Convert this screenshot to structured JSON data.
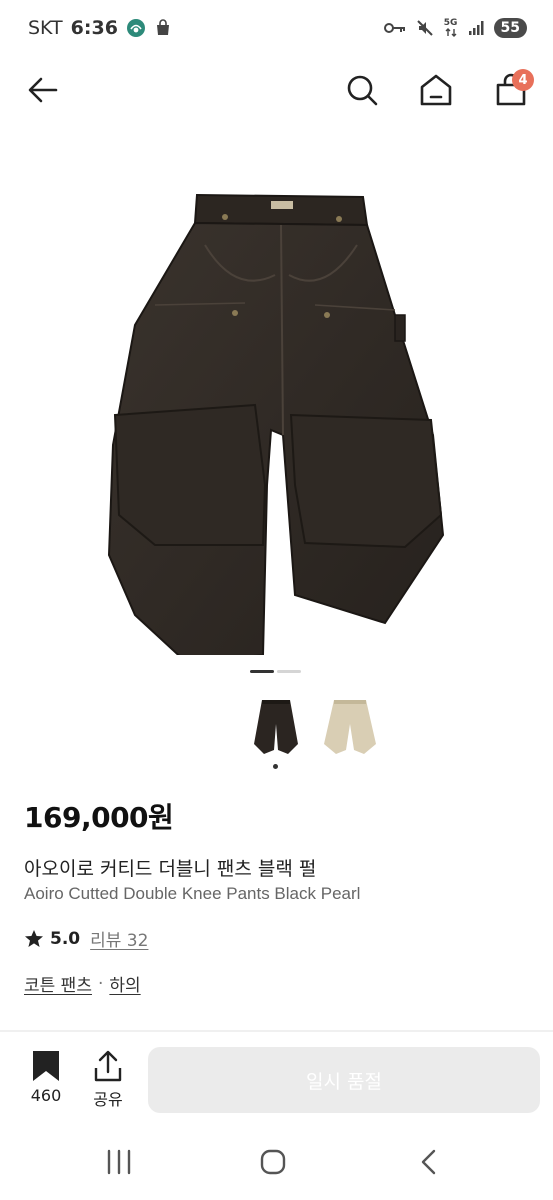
{
  "status": {
    "carrier": "SKT",
    "time": "6:36",
    "network": "5G",
    "battery": "55"
  },
  "header": {
    "back_icon": "arrow-left-icon",
    "search_icon": "search-icon",
    "home_icon": "home-icon",
    "cart_icon": "shopping-bag-icon",
    "cart_count": "4",
    "badge_color": "#e8705a"
  },
  "gallery": {
    "current_index": 1,
    "total": 2,
    "swatches": [
      "black",
      "beige"
    ]
  },
  "product": {
    "price": "169,000원",
    "name_ko": "아오이로 커티드 더블니 팬츠 블랙 펄",
    "name_en": "Aoiro Cutted Double Knee Pants Black Pearl",
    "rating": "5.0",
    "review_label": "리뷰 32",
    "category": "코튼 팬츠",
    "category_sep": "·",
    "subcategory": "하의"
  },
  "actions": {
    "like_count": "460",
    "share_label": "공유",
    "soldout_label": "일시 품절"
  }
}
